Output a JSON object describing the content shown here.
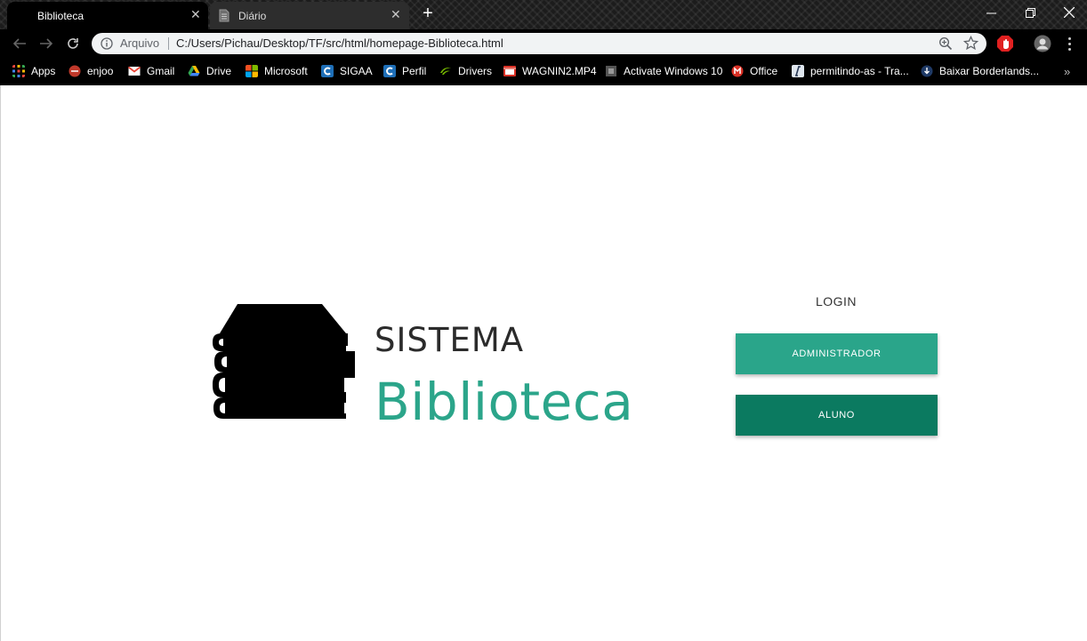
{
  "browser": {
    "tabs": [
      {
        "title": "Biblioteca",
        "active": true
      },
      {
        "title": "Diário",
        "active": false
      }
    ],
    "address_bar": {
      "security_label": "Arquivo",
      "url": "C:/Users/Pichau/Desktop/TF/src/html/homepage-Biblioteca.html"
    },
    "bookmarks": [
      {
        "label": "Apps",
        "icon": "apps-grid-icon",
        "color": "#e8453c"
      },
      {
        "label": "enjoo",
        "icon": "enjoo-icon",
        "color": "#c0392b"
      },
      {
        "label": "Gmail",
        "icon": "gmail-icon",
        "color": "#ea4335"
      },
      {
        "label": "Drive",
        "icon": "drive-icon",
        "color": "#fbbc04"
      },
      {
        "label": "Microsoft",
        "icon": "microsoft-icon",
        "color": "#7fba00"
      },
      {
        "label": "SIGAA",
        "icon": "sigaa-icon",
        "color": "#1e6fb8"
      },
      {
        "label": "Perfil",
        "icon": "perfil-icon",
        "color": "#1e6fb8"
      },
      {
        "label": "Drivers",
        "icon": "nvidia-icon",
        "color": "#76b900"
      },
      {
        "label": "WAGNIN2.MP4",
        "icon": "video-icon",
        "color": "#d93025"
      },
      {
        "label": "Activate Windows 10",
        "icon": "page-icon",
        "color": "#555555"
      },
      {
        "label": "Office",
        "icon": "office-icon",
        "color": "#d93025"
      },
      {
        "label": "permitindo-as - Tra...",
        "icon": "translate-icon",
        "color": "#4a6fa5"
      },
      {
        "label": "Baixar Borderlands...",
        "icon": "download-icon",
        "color": "#1a73e8"
      }
    ]
  },
  "page": {
    "brand": {
      "line1": "SISTEMA",
      "line2": "Biblioteca",
      "accent_color": "#2ba58a"
    },
    "login": {
      "title": "LOGIN",
      "admin_label": "ADMINISTRADOR",
      "aluno_label": "ALUNO"
    }
  }
}
